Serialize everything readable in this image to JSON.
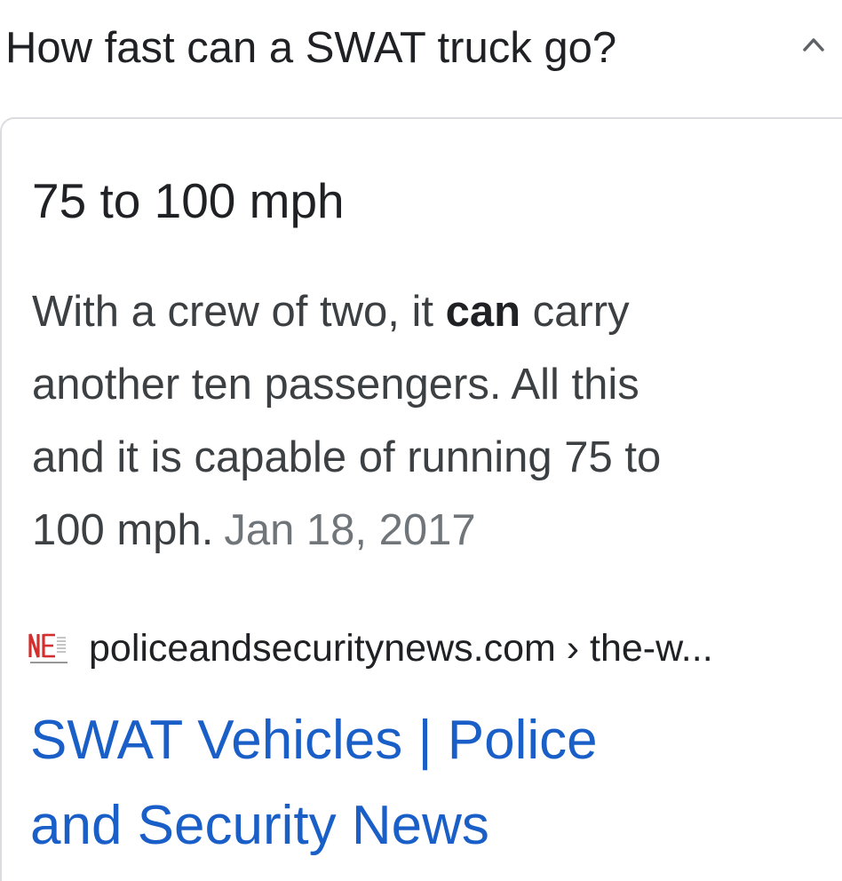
{
  "question": {
    "text": "How fast can a SWAT truck go?",
    "toggle_icon": "chevron-up-icon"
  },
  "answer": {
    "headline": "75 to 100 mph",
    "snippet": {
      "line1_pre": "With a crew of two, it ",
      "line1_bold": "can",
      "line1_post": " carry",
      "line2": "another ten passengers. All this",
      "line3": "and it is capable of running 75 to",
      "line4": "100 mph.",
      "date": "Jan 18, 2017"
    }
  },
  "source": {
    "favicon_icon": "site-logo-icon",
    "url_text": "policeandsecuritynews.com › the-w..."
  },
  "result": {
    "title_line1": "SWAT Vehicles | Police",
    "title_line2": "and Security News"
  },
  "colors": {
    "link": "#1a5fc7",
    "text": "#202124",
    "muted": "#70757a",
    "favicon_red": "#d32f2f"
  }
}
